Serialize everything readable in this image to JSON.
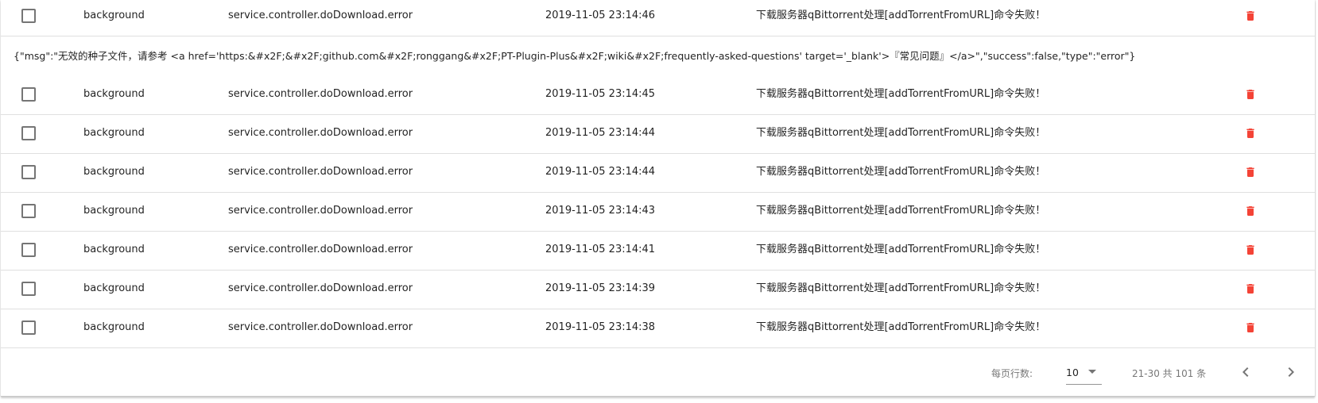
{
  "colors": {
    "delete": "#f44336",
    "divider": "#e0e0e0"
  },
  "icons": {
    "delete": "trash-can-icon",
    "prev": "chevron-left-icon",
    "next": "chevron-right-icon",
    "select": "caret-down-icon"
  },
  "rows": [
    {
      "source": "background",
      "event": "service.controller.doDownload.error",
      "time": "2019-11-05 23:14:46",
      "message": "下载服务器qBittorrent处理[addTorrentFromURL]命令失败！"
    },
    {
      "source": "background",
      "event": "service.controller.doDownload.error",
      "time": "2019-11-05 23:14:45",
      "message": "下载服务器qBittorrent处理[addTorrentFromURL]命令失败！"
    },
    {
      "source": "background",
      "event": "service.controller.doDownload.error",
      "time": "2019-11-05 23:14:44",
      "message": "下载服务器qBittorrent处理[addTorrentFromURL]命令失败！"
    },
    {
      "source": "background",
      "event": "service.controller.doDownload.error",
      "time": "2019-11-05 23:14:44",
      "message": "下载服务器qBittorrent处理[addTorrentFromURL]命令失败！"
    },
    {
      "source": "background",
      "event": "service.controller.doDownload.error",
      "time": "2019-11-05 23:14:43",
      "message": "下载服务器qBittorrent处理[addTorrentFromURL]命令失败！"
    },
    {
      "source": "background",
      "event": "service.controller.doDownload.error",
      "time": "2019-11-05 23:14:41",
      "message": "下载服务器qBittorrent处理[addTorrentFromURL]命令失败！"
    },
    {
      "source": "background",
      "event": "service.controller.doDownload.error",
      "time": "2019-11-05 23:14:39",
      "message": "下载服务器qBittorrent处理[addTorrentFromURL]命令失败！"
    },
    {
      "source": "background",
      "event": "service.controller.doDownload.error",
      "time": "2019-11-05 23:14:38",
      "message": "下载服务器qBittorrent处理[addTorrentFromURL]命令失败！"
    }
  ],
  "expanded_detail": "{\"msg\":\"无效的种子文件，请参考 <a href='https:&#x2F;&#x2F;github.com&#x2F;ronggang&#x2F;PT-Plugin-Plus&#x2F;wiki&#x2F;frequently-asked-questions' target='_blank'>『常见问题』</a>\",\"success\":false,\"type\":\"error\"}",
  "footer": {
    "rows_per_page_label": "每页行数:",
    "rows_per_page_value": "10",
    "range_text": "21-30 共 101 条"
  }
}
